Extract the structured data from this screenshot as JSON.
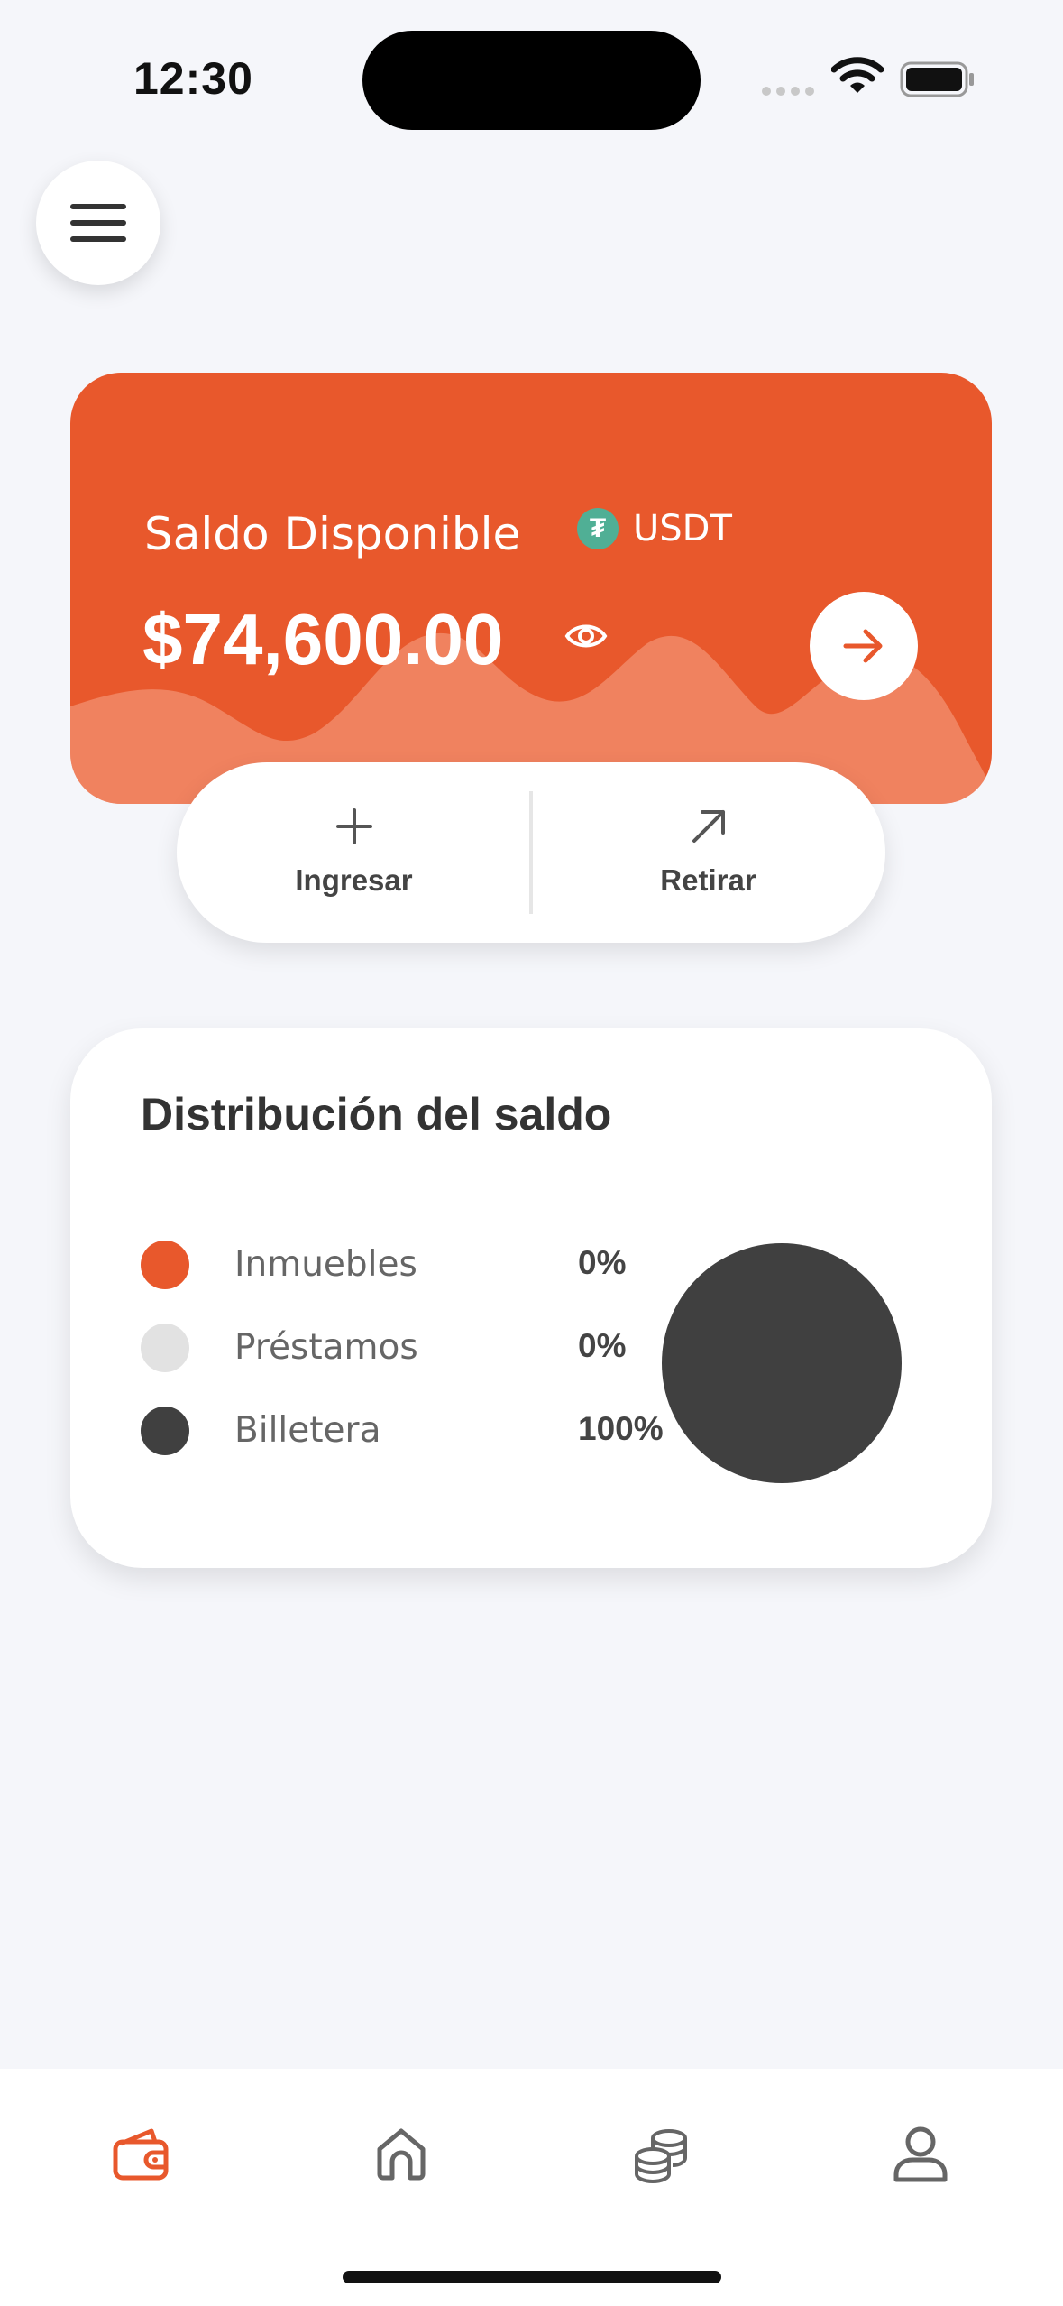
{
  "status_bar": {
    "time": "12:30"
  },
  "balance_card": {
    "label": "Saldo Disponible",
    "currency": "USDT",
    "currency_icon": "tether-icon",
    "amount": "$74,600.00",
    "accent_color": "#e8582c"
  },
  "actions": {
    "deposit_label": "Ingresar",
    "withdraw_label": "Retirar"
  },
  "distribution": {
    "title": "Distribución del saldo",
    "items": [
      {
        "name": "Inmuebles",
        "percent": "0%",
        "color": "#e8582c"
      },
      {
        "name": "Préstamos",
        "percent": "0%",
        "color": "#e2e2e2"
      },
      {
        "name": "Billetera",
        "percent": "100%",
        "color": "#404040"
      }
    ]
  },
  "chart_data": {
    "type": "pie",
    "categories": [
      "Inmuebles",
      "Préstamos",
      "Billetera"
    ],
    "values": [
      0,
      0,
      100
    ],
    "colors": [
      "#e8582c",
      "#e2e2e2",
      "#404040"
    ]
  },
  "bottom_nav": {
    "items": [
      {
        "icon": "wallet-icon",
        "active": true
      },
      {
        "icon": "home-icon",
        "active": false
      },
      {
        "icon": "coins-icon",
        "active": false
      },
      {
        "icon": "profile-icon",
        "active": false
      }
    ],
    "active_color": "#e8582c",
    "inactive_color": "#666666"
  }
}
